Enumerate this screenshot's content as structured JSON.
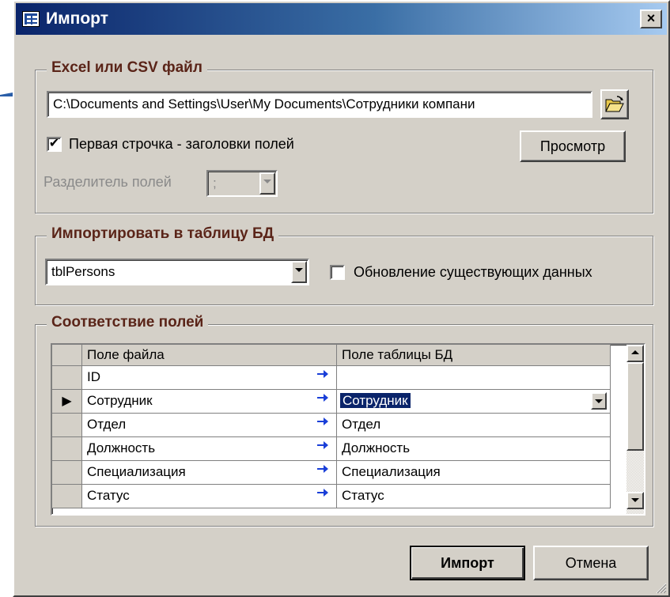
{
  "window": {
    "title": "Импорт",
    "close_label": "×"
  },
  "file_group": {
    "title": "Excel или CSV файл",
    "path_value": "C:\\Documents and Settings\\User\\My Documents\\Сотрудники компани",
    "first_row_headers_label": "Первая строчка - заголовки полей",
    "first_row_headers_checked": true,
    "check_mark": "✔",
    "preview_button": "Просмотр",
    "separator_label": "Разделитель полей",
    "separator_value": ";"
  },
  "table_group": {
    "title": "Импортировать в таблицу БД",
    "table_value": "tblPersons",
    "update_existing_label": "Обновление существующих данных",
    "update_existing_checked": false
  },
  "mapping_group": {
    "title": "Соответствие полей",
    "columns": [
      "Поле файла",
      "Поле таблицы БД"
    ],
    "current_row_marker": "▶",
    "rows": [
      {
        "file_field": "ID",
        "db_field": ""
      },
      {
        "file_field": "Сотрудник",
        "db_field": "Сотрудник"
      },
      {
        "file_field": "Отдел",
        "db_field": "Отдел"
      },
      {
        "file_field": "Должность",
        "db_field": "Должность"
      },
      {
        "file_field": "Специализация",
        "db_field": "Специализация"
      },
      {
        "file_field": "Статус",
        "db_field": "Статус"
      }
    ]
  },
  "buttons": {
    "import": "Импорт",
    "cancel": "Отмена"
  },
  "colors": {
    "accent_blue": "#0a246a",
    "group_title": "#5a2418",
    "face": "#d4d0c8",
    "arrow_blue": "#1a3fd8"
  }
}
